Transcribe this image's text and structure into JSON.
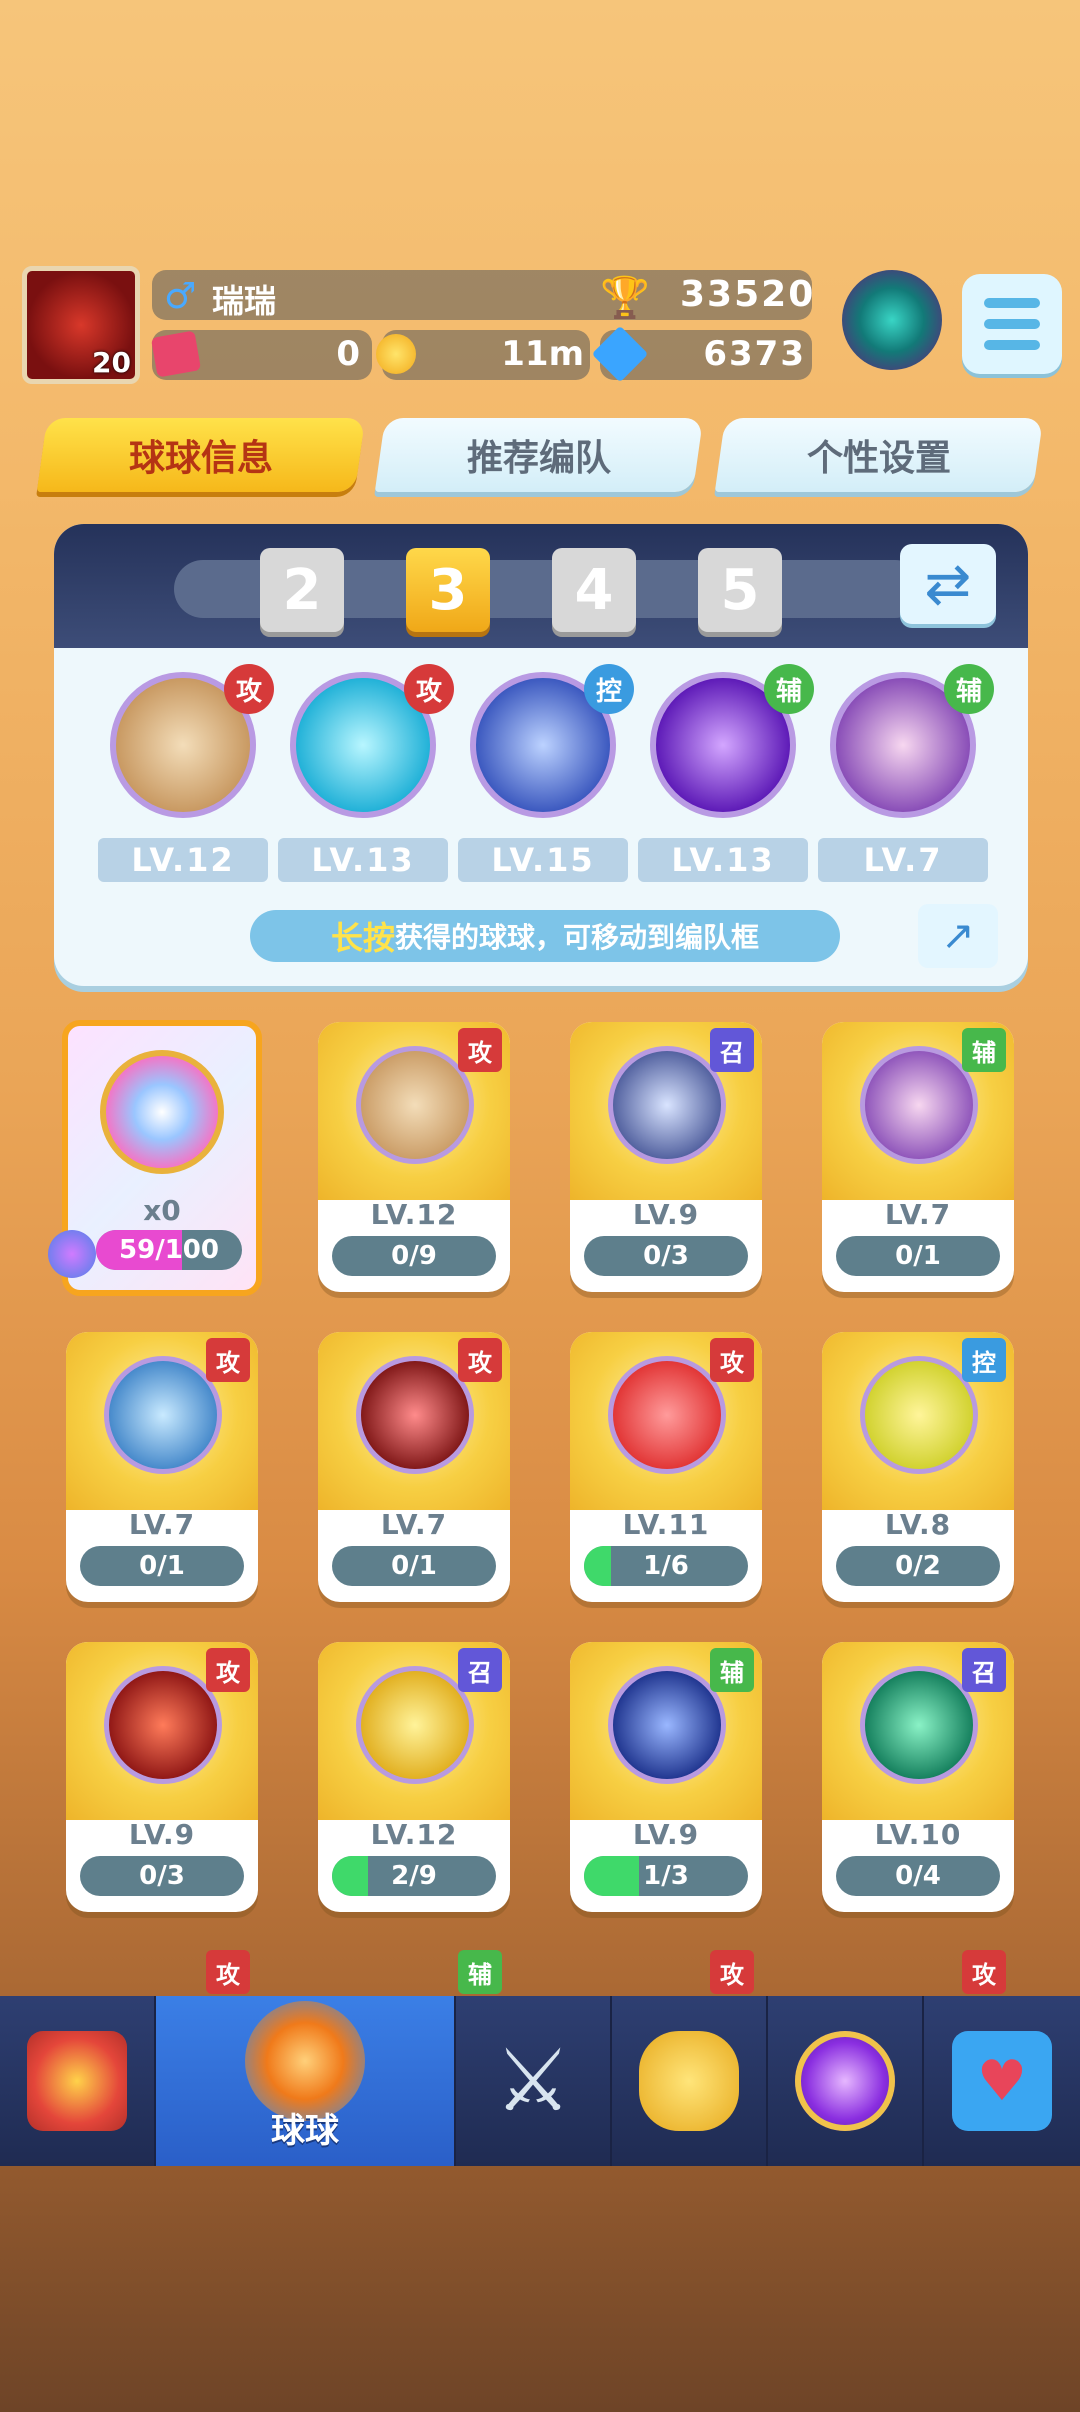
{
  "player": {
    "avatar_level": "20",
    "name": "瑞瑞",
    "gender_icon": "male-icon",
    "trophies": "33520",
    "tickets": "0",
    "coins": "11m",
    "gems": "6373"
  },
  "tabs": [
    "球球信息",
    "推荐编队",
    "个性设置"
  ],
  "team": {
    "pages": [
      "2",
      "3",
      "4",
      "5"
    ],
    "selected_page": "3",
    "members": [
      {
        "tag": "攻",
        "level": "LV.12"
      },
      {
        "tag": "攻",
        "level": "LV.13"
      },
      {
        "tag": "控",
        "level": "LV.15"
      },
      {
        "tag": "辅",
        "level": "LV.13"
      },
      {
        "tag": "辅",
        "level": "LV.7"
      }
    ],
    "hint_highlight": "长按",
    "hint_text": "获得的球球，可移动到编队框"
  },
  "special_card": {
    "count": "x0",
    "progress": "59/100",
    "progress_value": 0.59
  },
  "cards": [
    {
      "tag": "攻",
      "level": "LV.12",
      "progress": "0/9",
      "progress_value": 0
    },
    {
      "tag": "召",
      "level": "LV.9",
      "progress": "0/3",
      "progress_value": 0
    },
    {
      "tag": "辅",
      "level": "LV.7",
      "progress": "0/1",
      "progress_value": 0
    },
    {
      "tag": "攻",
      "level": "LV.7",
      "progress": "0/1",
      "progress_value": 0
    },
    {
      "tag": "攻",
      "level": "LV.7",
      "progress": "0/1",
      "progress_value": 0
    },
    {
      "tag": "攻",
      "level": "LV.11",
      "progress": "1/6",
      "progress_value": 0.167
    },
    {
      "tag": "控",
      "level": "LV.8",
      "progress": "0/2",
      "progress_value": 0
    },
    {
      "tag": "攻",
      "level": "LV.9",
      "progress": "0/3",
      "progress_value": 0
    },
    {
      "tag": "召",
      "level": "LV.12",
      "progress": "2/9",
      "progress_value": 0.222
    },
    {
      "tag": "辅",
      "level": "LV.9",
      "progress": "1/3",
      "progress_value": 0.333
    },
    {
      "tag": "召",
      "level": "LV.10",
      "progress": "0/4",
      "progress_value": 0
    }
  ],
  "partial_tags": [
    "攻",
    "辅",
    "攻",
    "攻"
  ],
  "nav": {
    "active_label": "球球"
  },
  "colors": {
    "attack": "#d63a3a",
    "control": "#3a9be0",
    "support": "#47b84b",
    "summon": "#6257d8"
  }
}
